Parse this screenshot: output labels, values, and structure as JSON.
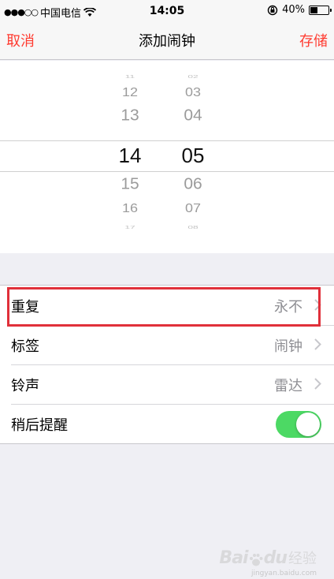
{
  "status_bar": {
    "signal": "●●●○○",
    "carrier": "中国电信",
    "time": "14:05",
    "battery_percent": "40%",
    "battery_level": 0.4
  },
  "nav": {
    "cancel": "取消",
    "title": "添加闹钟",
    "save": "存储"
  },
  "picker": {
    "hours": [
      "11",
      "12",
      "13",
      "14",
      "15",
      "16",
      "17"
    ],
    "minutes": [
      "02",
      "03",
      "04",
      "05",
      "06",
      "07",
      "08"
    ],
    "selected_hour": "14",
    "selected_minute": "05"
  },
  "settings": {
    "repeat": {
      "label": "重复",
      "value": "永不"
    },
    "label": {
      "label": "标签",
      "value": "闹钟"
    },
    "sound": {
      "label": "铃声",
      "value": "雷达"
    },
    "snooze": {
      "label": "稍后提醒",
      "on": true
    }
  },
  "colors": {
    "accent": "#ff3b30",
    "toggle_on": "#4cd964",
    "highlight": "#e0303a"
  },
  "watermark": {
    "logo": "Baidu",
    "text": "经验",
    "url": "jingyan.baidu.com"
  }
}
